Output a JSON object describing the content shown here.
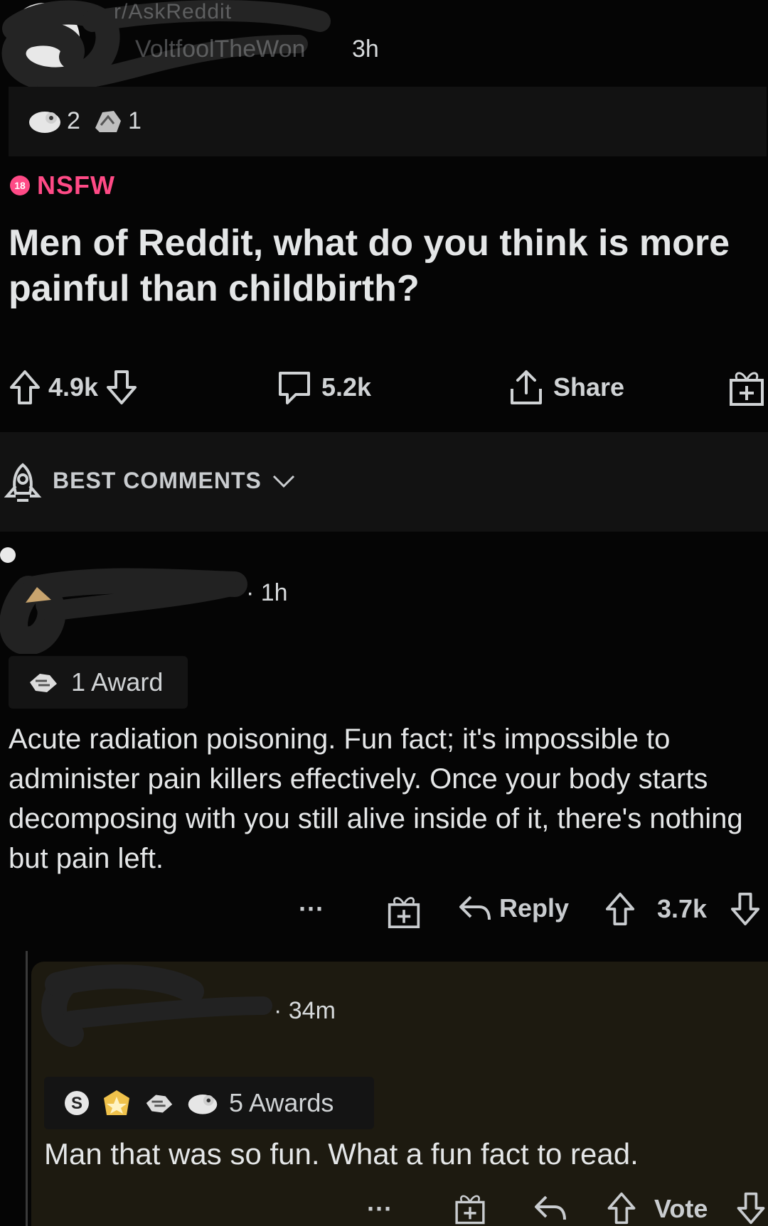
{
  "post": {
    "subreddit": "r/AskReddit",
    "author": "VoltfoolTheWon",
    "time": "3h",
    "awards": [
      {
        "icon": "wholesome-award-icon",
        "count": "2"
      },
      {
        "icon": "silver-award-icon",
        "count": "1"
      }
    ],
    "nsfw_badge": "18",
    "nsfw_label": "NSFW",
    "title": "Men of Reddit, what do you think is more painful than childbirth?",
    "upvotes": "4.9k",
    "comments": "5.2k",
    "share_label": "Share"
  },
  "sort": {
    "label": "BEST COMMENTS"
  },
  "comments": [
    {
      "time": "· 1h",
      "award_label": "1 Award",
      "body": "Acute radiation poisoning. Fun fact; it's impossible to administer pain killers effectively. Once your body starts decomposing with you still alive inside of it, there's nothing but pain left.",
      "more_label": "···",
      "reply_label": "Reply",
      "score": "3.7k"
    },
    {
      "time": "· 34m",
      "award_label": "5 Awards",
      "body": "Man that was so fun. What a fun fact to read.",
      "more_label": "···",
      "vote_label": "Vote"
    }
  ],
  "colors": {
    "background": "#050505",
    "nsfw": "#ff4a86",
    "reply_highlight": "#1d1a10",
    "panel": "#121212"
  }
}
